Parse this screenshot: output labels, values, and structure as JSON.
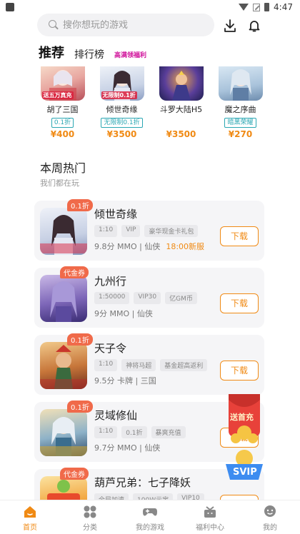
{
  "status_bar": {
    "time": "4:47"
  },
  "search": {
    "placeholder": "搜你想玩的游戏"
  },
  "tabs": {
    "active": "推荐",
    "second": "排行榜",
    "third": "高满领福利"
  },
  "recommended": [
    {
      "name": "胡了三国",
      "tag": "0.1折",
      "price": "¥400",
      "image_label": "送五万真充"
    },
    {
      "name": "倾世奇缘",
      "tag": "无限制0.1折",
      "price": "¥3500",
      "image_label": "无限制0.1折"
    },
    {
      "name": "斗罗大陆H5",
      "tag": "",
      "price": "¥3500",
      "image_label": ""
    },
    {
      "name": "魔之序曲",
      "tag": "暗黑荣耀",
      "price": "¥270",
      "image_label": ""
    }
  ],
  "section": {
    "title": "本周热门",
    "subtitle": "我们都在玩"
  },
  "games": [
    {
      "badge": "0.1折",
      "name": "倾世奇缘",
      "tags": [
        "1:10",
        "VIP",
        "豪华现金卡礼包"
      ],
      "meta": "9.8分  MMO | 仙侠",
      "highlight": "18:00新服",
      "button": "下载"
    },
    {
      "badge": "代金券",
      "name": "九州行",
      "tags": [
        "1:50000",
        "VIP30",
        "亿GM币"
      ],
      "meta": "9分  MMO | 仙侠",
      "highlight": "",
      "button": "下载"
    },
    {
      "badge": "0.1折",
      "name": "天子令",
      "tags": [
        "1:10",
        "神将马超",
        "基金超高返利"
      ],
      "meta": "9.5分  卡牌 | 三国",
      "highlight": "",
      "button": "下载"
    },
    {
      "badge": "0.1折",
      "name": "灵域修仙",
      "tags": [
        "1:10",
        "0.1折",
        "暴爽充值"
      ],
      "meta": "9.7分  MMO | 仙侠",
      "highlight": "",
      "button": "下载"
    },
    {
      "badge": "代金券",
      "name": "葫芦兄弟：七子降妖",
      "tags": [
        "全局加速",
        "100W元宝",
        "VIP10"
      ],
      "meta": "",
      "highlight": "",
      "button": "下载"
    }
  ],
  "floating": {
    "redpack_label": "送首充",
    "svip_label": "SVIP"
  },
  "bottom_nav": [
    {
      "label": "首页",
      "icon": "home-icon"
    },
    {
      "label": "分类",
      "icon": "category-icon"
    },
    {
      "label": "我的游戏",
      "icon": "gamepad-icon"
    },
    {
      "label": "福利中心",
      "icon": "gift-icon"
    },
    {
      "label": "我的",
      "icon": "profile-icon"
    }
  ],
  "colors": {
    "accent": "#f08a14",
    "badge": "#f06a4a",
    "teal": "#2aa7b3"
  }
}
